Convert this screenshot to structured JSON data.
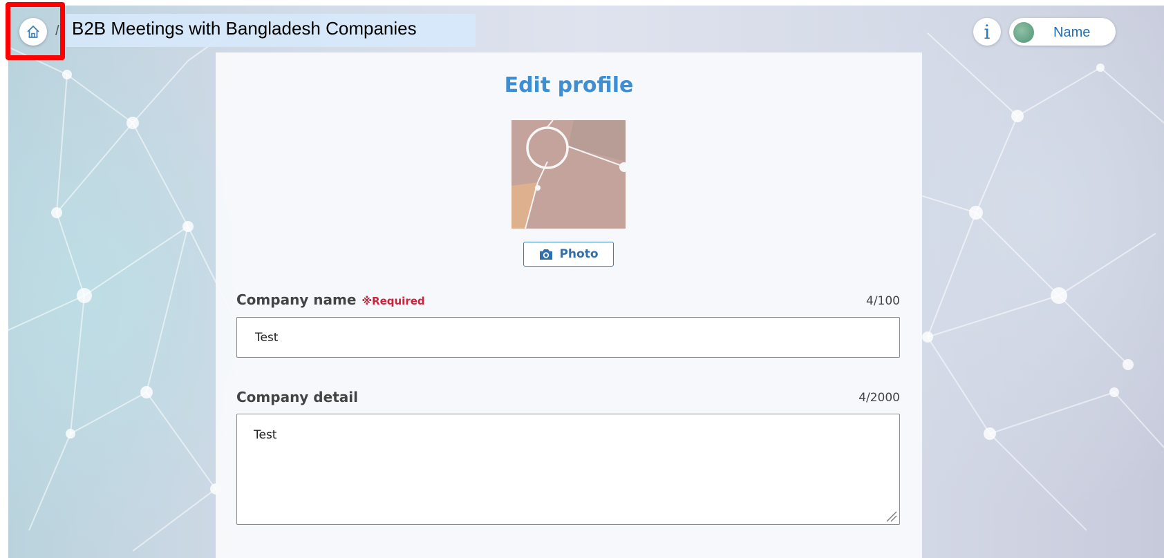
{
  "header": {
    "event_title": "B2B Meetings with Bangladesh Companies",
    "separator": "/",
    "info_glyph": "i",
    "user_name": "Name",
    "home_icon": "home-icon"
  },
  "form": {
    "page_title": "Edit profile",
    "photo_button_label": "Photo",
    "photo_icon": "camera-icon",
    "company_name": {
      "label": "Company name",
      "required_label": "※Required",
      "counter": "4/100",
      "value": "Test"
    },
    "company_detail": {
      "label": "Company detail",
      "counter": "4/2000",
      "value": "Test"
    }
  },
  "colors": {
    "accent": "#3d8ed3",
    "required": "#d0203a",
    "highlight": "#ff0000"
  }
}
